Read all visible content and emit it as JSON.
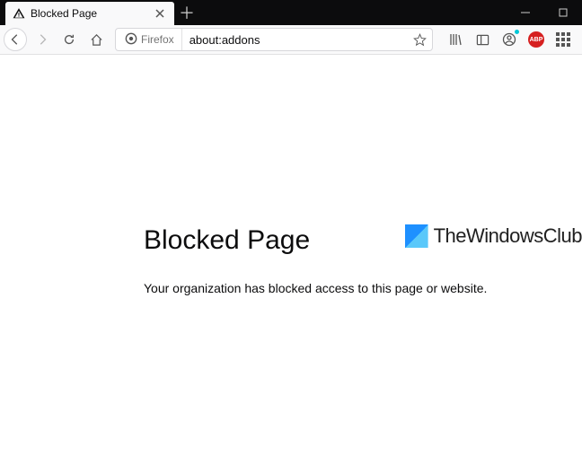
{
  "titlebar": {
    "tab": {
      "label": "Blocked Page"
    }
  },
  "navbar": {
    "identity_label": "Firefox",
    "url_value": "about:addons"
  },
  "content": {
    "heading": "Blocked Page",
    "message": "Your organization has blocked access to this page or website."
  },
  "watermark": {
    "text": "TheWindowsClub"
  }
}
